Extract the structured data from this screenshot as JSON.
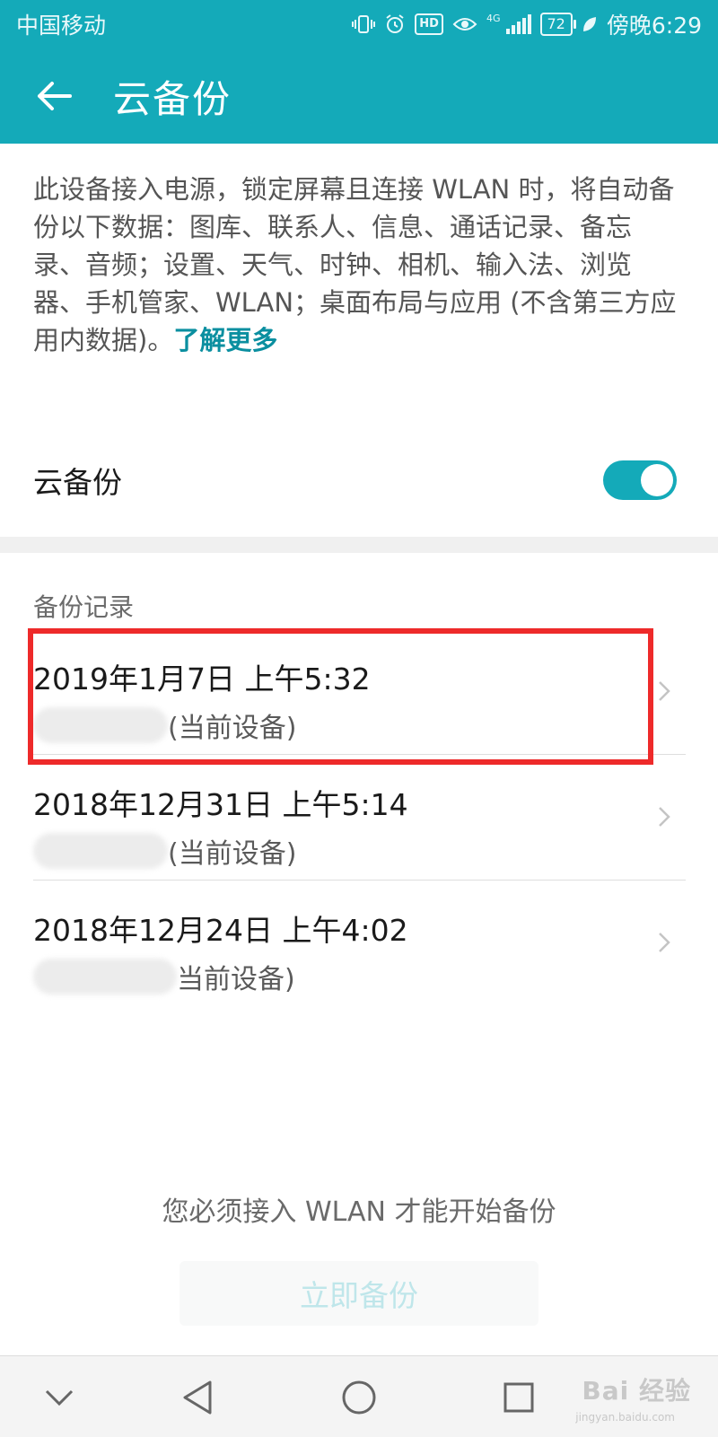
{
  "status_bar": {
    "carrier": "中国移动",
    "network": "4G",
    "battery": "72",
    "time": "傍晚6:29",
    "icons": [
      "vibrate-icon",
      "alarm-icon",
      "hd-icon",
      "eye-comfort-icon",
      "signal-icon",
      "battery-icon",
      "leaf-icon"
    ],
    "hd_label": "HD"
  },
  "appbar": {
    "title": "云备份",
    "back_icon": "arrow-left-icon"
  },
  "description": {
    "text": "此设备接入电源，锁定屏幕且连接 WLAN 时，将自动备份以下数据：图库、联系人、信息、通话记录、备忘录、音频；设置、天气、时钟、相机、输入法、浏览器、手机管家、WLAN；桌面布局与应用 (不含第三方应用内数据)。",
    "learn_more": "了解更多"
  },
  "cloud_backup_toggle": {
    "label": "云备份",
    "on": true
  },
  "records": {
    "header": "备份记录",
    "items": [
      {
        "date": "2019年1月7日 上午5:32",
        "device": "(当前设备)"
      },
      {
        "date": "2018年12月31日 上午5:14",
        "device": "(当前设备)"
      },
      {
        "date": "2018年12月24日 上午4:02",
        "device": "当前设备)"
      }
    ]
  },
  "footer": {
    "wlan_note": "您必须接入 WLAN 才能开始备份",
    "backup_now": "立即备份"
  },
  "watermark": {
    "brand": "Bai 经验",
    "url": "jingyan.baidu.com"
  },
  "colors": {
    "accent": "#14aab9",
    "link": "#0b8fa0",
    "highlight": "#ee2a2a"
  }
}
